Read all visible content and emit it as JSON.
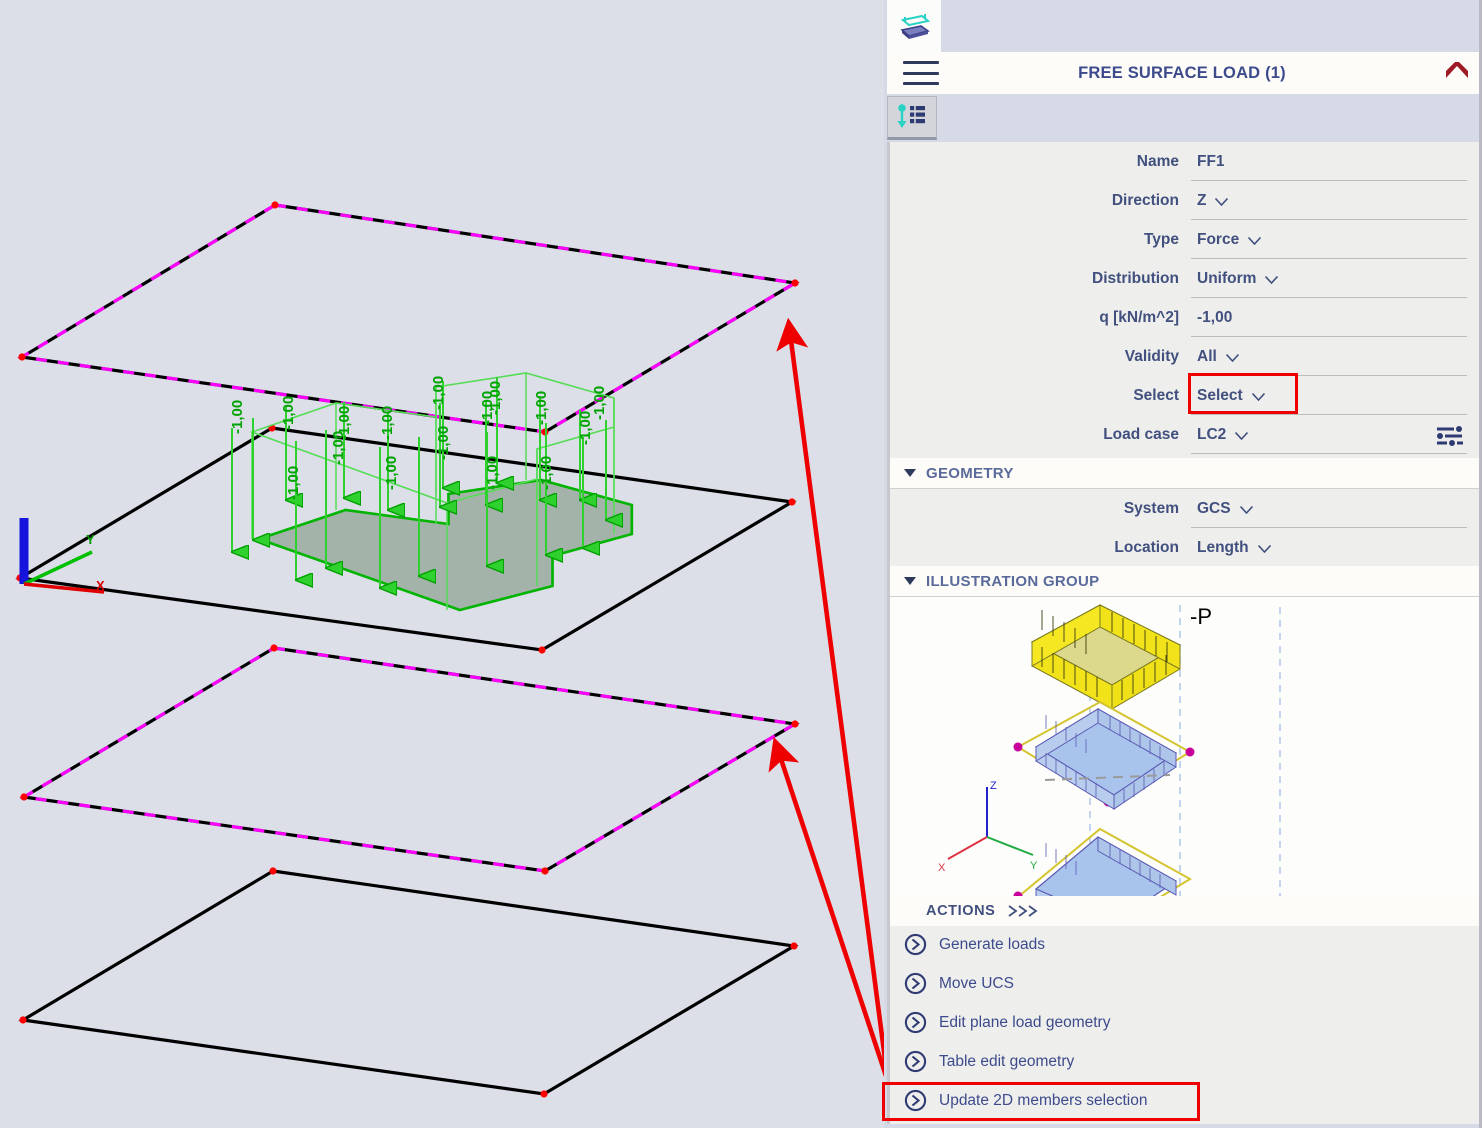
{
  "panel": {
    "tab_icon": "free-surface-load-icon",
    "title": "FREE SURFACE LOAD (1)",
    "menu_icon": "hamburger-icon",
    "collapse_icon": "chevron-up-icon",
    "subtab_icon": "load-table-icon",
    "settings_icon": "sliders-icon"
  },
  "properties": [
    {
      "label": "Name",
      "value": "FF1",
      "dropdown": false
    },
    {
      "label": "Direction",
      "value": "Z",
      "dropdown": true
    },
    {
      "label": "Type",
      "value": "Force",
      "dropdown": true
    },
    {
      "label": "Distribution",
      "value": "Uniform",
      "dropdown": true
    },
    {
      "label": "q [kN/m^2]",
      "value": "-1,00",
      "dropdown": false
    },
    {
      "label": "Validity",
      "value": "All",
      "dropdown": true
    },
    {
      "label": "Select",
      "value": "Select",
      "dropdown": true
    },
    {
      "label": "Load case",
      "value": "LC2",
      "dropdown": true
    }
  ],
  "geometry": {
    "header": "GEOMETRY",
    "rows": [
      {
        "label": "System",
        "value": "GCS",
        "dropdown": true
      },
      {
        "label": "Location",
        "value": "Length",
        "dropdown": true
      }
    ]
  },
  "illustration": {
    "header": "ILLUSTRATION GROUP",
    "load_label": "-P",
    "axis_x": "X",
    "axis_y": "Y",
    "axis_z": "Z"
  },
  "actions": {
    "header": "ACTIONS",
    "items": [
      {
        "label": "Generate loads"
      },
      {
        "label": "Move UCS"
      },
      {
        "label": "Edit plane load geometry"
      },
      {
        "label": "Table edit geometry"
      },
      {
        "label": "Update 2D members selection"
      }
    ]
  },
  "viewport": {
    "load_value_label": "-1,00",
    "axis_x": "X",
    "axis_y": "Y",
    "axis_z": "Z",
    "background": "#dcdee8",
    "load_color": "#00c000",
    "selected_edge_color": "#ff00ff",
    "edge_color": "#000000",
    "node_color": "#ff0000",
    "annotation_color": "#ee0000"
  },
  "colors": {
    "accent": "#3d4b8c",
    "highlight": "#ee0000",
    "panel_bg": "#d6dae6",
    "field_bg": "#eeeeec",
    "header_bg": "#fdfcf8"
  }
}
